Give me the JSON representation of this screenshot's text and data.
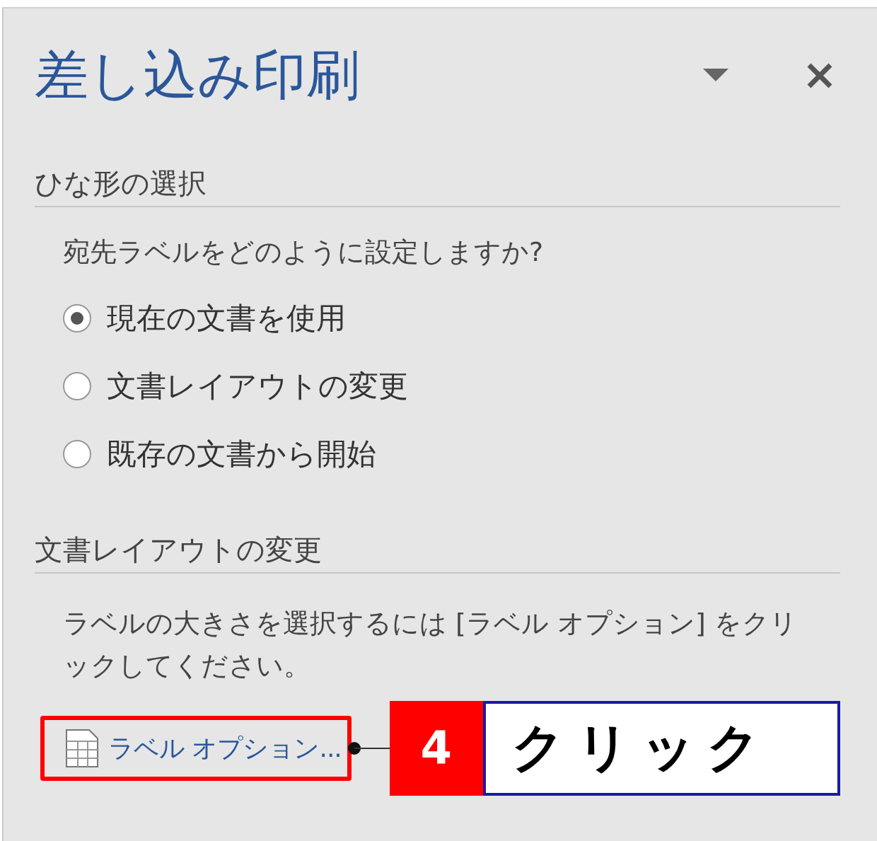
{
  "panel": {
    "title": "差し込み印刷",
    "sections": [
      {
        "heading": "ひな形の選択",
        "question": "宛先ラベルをどのように設定しますか?",
        "options": [
          {
            "label": "現在の文書を使用",
            "selected": true
          },
          {
            "label": "文書レイアウトの変更",
            "selected": false
          },
          {
            "label": "既存の文書から開始",
            "selected": false
          }
        ]
      },
      {
        "heading": "文書レイアウトの変更",
        "description": "ラベルの大きさを選択するには [ラベル オプション] をクリックしてください。",
        "link": "ラベル オプション..."
      }
    ]
  },
  "annotation": {
    "step": "4",
    "text": "クリック"
  }
}
